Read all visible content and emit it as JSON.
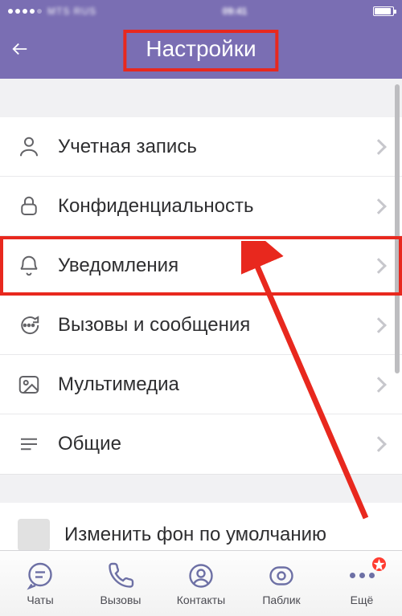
{
  "header": {
    "title": "Настройки"
  },
  "settings": {
    "items": [
      {
        "label": "Учетная запись"
      },
      {
        "label": "Конфиденциальность"
      },
      {
        "label": "Уведомления"
      },
      {
        "label": "Вызовы и сообщения"
      },
      {
        "label": "Мультимедиа"
      },
      {
        "label": "Общие"
      }
    ],
    "background_row": {
      "label": "Изменить фон по умолчанию"
    }
  },
  "tabs": {
    "chats": "Чаты",
    "calls": "Вызовы",
    "contacts": "Контакты",
    "public": "Паблик",
    "more": "Ещё"
  },
  "annotation": {
    "highlight_index": 2
  }
}
